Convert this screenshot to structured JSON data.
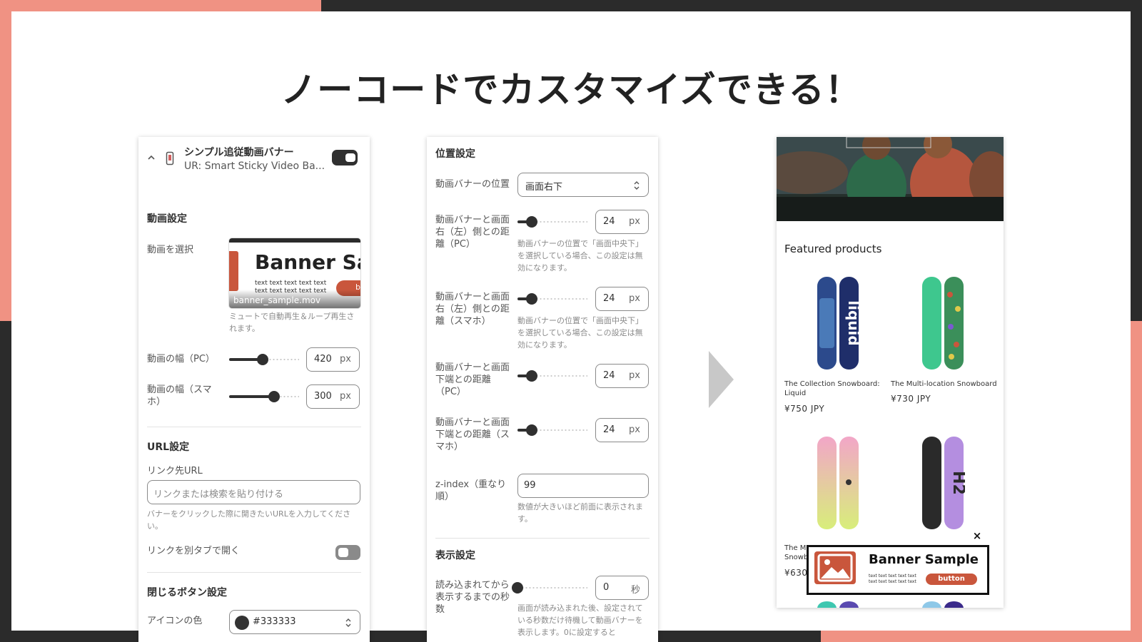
{
  "headline": "ノーコードでカスタマイズできる！",
  "left_panel": {
    "app_title": "シンプル追従動画バナー",
    "app_subtitle": "UR: Smart Sticky Video Ba...",
    "app_enabled": true,
    "video_section": {
      "title": "動画設定",
      "select_label": "動画を選択",
      "thumbnail_heading": "Banner Sa",
      "thumbnail_body_1": "text text text text text",
      "thumbnail_body_2": "text text text text text",
      "thumbnail_button": "b",
      "file_name": "banner_sample.mov",
      "select_help": "ミュートで自動再生＆ループ再生されます。",
      "width_pc_label": "動画の幅（PC）",
      "width_pc_value": "420",
      "width_pc_level": 0.48,
      "width_sp_label": "動画の幅（スマホ）",
      "width_sp_value": "300",
      "width_sp_level": 0.64,
      "unit": "px"
    },
    "url_section": {
      "title": "URL設定",
      "link_label": "リンク先URL",
      "link_placeholder": "リンクまたは検索を貼り付ける",
      "link_help": "バナーをクリックした際に開きたいURLを入力してください。",
      "new_tab_label": "リンクを別タブで開く",
      "new_tab_enabled": false
    },
    "close_section": {
      "title": "閉じるボタン設定",
      "icon_color_label": "アイコンの色",
      "icon_color_value": "#333333",
      "icon_color_swatch": "#333333"
    }
  },
  "mid_panel": {
    "position_section": {
      "title": "位置設定",
      "position_label": "動画バナーの位置",
      "position_value": "画面右下",
      "right_pc_label": "動画バナーと画面右（左）側との距離（PC）",
      "right_pc_value": "24",
      "right_pc_help": "動画バナーの位置で「画面中央下」を選択している場合、この設定は無効になります。",
      "right_sp_label": "動画バナーと画面右（左）側との距離（スマホ）",
      "right_sp_value": "24",
      "right_sp_help": "動画バナーの位置で「画面中央下」を選択している場合、この設定は無効になります。",
      "bottom_pc_label": "動画バナーと画面下端との距離（PC）",
      "bottom_pc_value": "24",
      "bottom_sp_label": "動画バナーと画面下端との距離（スマホ）",
      "bottom_sp_value": "24",
      "zindex_label": "z-index（重なり順）",
      "zindex_value": "99",
      "zindex_help": "数値が大きいほど前面に表示されます。",
      "unit": "px",
      "distance_level": 0.2
    },
    "display_section": {
      "title": "表示設定",
      "delay_label": "読み込まれてから表示するまでの秒数",
      "delay_value": "0",
      "delay_unit": "秒",
      "delay_level": 0.0,
      "delay_help": "画面が読み込まれた後、設定されている秒数だけ待機して動画バナーを表示します。0に設定すると"
    }
  },
  "right_panel": {
    "featured_title": "Featured products",
    "products": [
      {
        "title": "The Collection Snowboard: Liquid",
        "price": "¥750 JPY",
        "board_label": "liquid"
      },
      {
        "title": "The Multi-location Snowboard",
        "price": "¥730 JPY"
      },
      {
        "title": "The Ma",
        "title_line2": "Snowb",
        "price": "¥630"
      },
      {
        "title": "",
        "price": "",
        "board_label": "H2"
      }
    ],
    "banner": {
      "heading": "Banner Sample",
      "body_1": "text text text text text",
      "body_2": "text text text text text",
      "button": "button",
      "close": "×"
    }
  },
  "colors": {
    "accent_salmon": "#f09283",
    "frame_dark": "#2b2b2b",
    "banner_red": "#c9563c"
  }
}
